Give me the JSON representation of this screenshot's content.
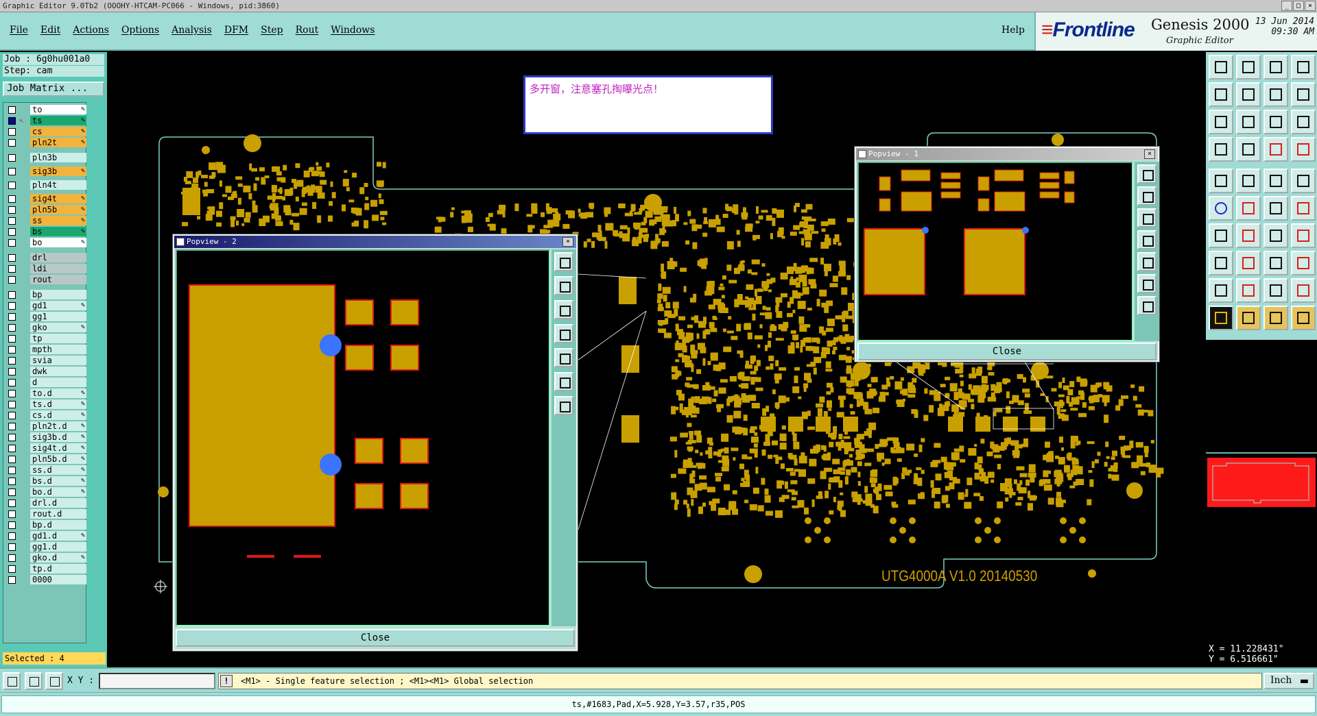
{
  "window": {
    "title": "Graphic Editor 9.0Tb2  (OOOHY-HTCAM-PC066 - Windows, pid:3860)"
  },
  "menu": {
    "items": [
      "File",
      "Edit",
      "Actions",
      "Options",
      "Analysis",
      "DFM",
      "Step",
      "Rout",
      "Windows"
    ],
    "help": "Help"
  },
  "brand": {
    "logo": "Frontline",
    "product": "Genesis 2000",
    "subtitle": "Graphic Editor",
    "date": "13 Jun 2014",
    "time": "09:30 AM"
  },
  "job": {
    "job_line": "Job : 6g0hu001a0",
    "step_line": "Step: cam",
    "matrix_button": "Job Matrix ..."
  },
  "layers": [
    {
      "name": "to",
      "color": "#ffffff",
      "checked": false,
      "editable": true
    },
    {
      "name": "ts",
      "color": "#1aa870",
      "checked": true,
      "editable": true
    },
    {
      "name": "cs",
      "color": "#f2b43c",
      "checked": false,
      "editable": true
    },
    {
      "name": "pln2t",
      "color": "#f2b43c",
      "checked": false,
      "editable": true
    },
    {
      "name": "pln3b",
      "color": "#cdeee9",
      "checked": false,
      "editable": false
    },
    {
      "name": "sig3b",
      "color": "#f2b43c",
      "checked": false,
      "editable": true
    },
    {
      "name": "pln4t",
      "color": "#cdeee9",
      "checked": false,
      "editable": false
    },
    {
      "name": "sig4t",
      "color": "#f2b43c",
      "checked": false,
      "editable": true
    },
    {
      "name": "pln5b",
      "color": "#f2b43c",
      "checked": false,
      "editable": true
    },
    {
      "name": "ss",
      "color": "#f2b43c",
      "checked": false,
      "editable": true
    },
    {
      "name": "bs",
      "color": "#1aa870",
      "checked": false,
      "editable": true
    },
    {
      "name": "bo",
      "color": "#ffffff",
      "checked": false,
      "editable": true
    },
    {
      "name": "drl",
      "color": "#b8c8c6",
      "checked": false,
      "editable": false
    },
    {
      "name": "ldi",
      "color": "#b8c8c6",
      "checked": false,
      "editable": false
    },
    {
      "name": "rout",
      "color": "#b8c8c6",
      "checked": false,
      "editable": false
    },
    {
      "name": "bp",
      "color": "#cdeee9",
      "checked": false,
      "editable": false
    },
    {
      "name": "gd1",
      "color": "#cdeee9",
      "checked": false,
      "editable": true
    },
    {
      "name": "gg1",
      "color": "#cdeee9",
      "checked": false,
      "editable": false
    },
    {
      "name": "gko",
      "color": "#cdeee9",
      "checked": false,
      "editable": true
    },
    {
      "name": "tp",
      "color": "#cdeee9",
      "checked": false,
      "editable": false
    },
    {
      "name": "mpth",
      "color": "#cdeee9",
      "checked": false,
      "editable": false
    },
    {
      "name": "svia",
      "color": "#cdeee9",
      "checked": false,
      "editable": false
    },
    {
      "name": "dwk",
      "color": "#cdeee9",
      "checked": false,
      "editable": false
    },
    {
      "name": "d",
      "color": "#cdeee9",
      "checked": false,
      "editable": false
    },
    {
      "name": "to.d",
      "color": "#cdeee9",
      "checked": false,
      "editable": true
    },
    {
      "name": "ts.d",
      "color": "#cdeee9",
      "checked": false,
      "editable": true
    },
    {
      "name": "cs.d",
      "color": "#cdeee9",
      "checked": false,
      "editable": true
    },
    {
      "name": "pln2t.d",
      "color": "#cdeee9",
      "checked": false,
      "editable": true
    },
    {
      "name": "sig3b.d",
      "color": "#cdeee9",
      "checked": false,
      "editable": true
    },
    {
      "name": "sig4t.d",
      "color": "#cdeee9",
      "checked": false,
      "editable": true
    },
    {
      "name": "pln5b.d",
      "color": "#cdeee9",
      "checked": false,
      "editable": true
    },
    {
      "name": "ss.d",
      "color": "#cdeee9",
      "checked": false,
      "editable": true
    },
    {
      "name": "bs.d",
      "color": "#cdeee9",
      "checked": false,
      "editable": true
    },
    {
      "name": "bo.d",
      "color": "#cdeee9",
      "checked": false,
      "editable": true
    },
    {
      "name": "drl.d",
      "color": "#cdeee9",
      "checked": false,
      "editable": false
    },
    {
      "name": "rout.d",
      "color": "#cdeee9",
      "checked": false,
      "editable": false
    },
    {
      "name": "bp.d",
      "color": "#cdeee9",
      "checked": false,
      "editable": false
    },
    {
      "name": "gd1.d",
      "color": "#cdeee9",
      "checked": false,
      "editable": true
    },
    {
      "name": "gg1.d",
      "color": "#cdeee9",
      "checked": false,
      "editable": false
    },
    {
      "name": "gko.d",
      "color": "#cdeee9",
      "checked": false,
      "editable": true
    },
    {
      "name": "tp.d",
      "color": "#cdeee9",
      "checked": false,
      "editable": false
    },
    {
      "name": "0000",
      "color": "#cdeee9",
      "checked": false,
      "editable": false
    }
  ],
  "selected": "Selected : 4",
  "canvas": {
    "note": "多开窗，注意塞孔掏曝光点！",
    "board_label": "UTG4000A V1.0  20140530",
    "colors": {
      "pad": "#c9a000",
      "pad_outline": "#e01818",
      "board_outline": "#7fd0c8",
      "highlight": "#3a74ff"
    }
  },
  "popview1": {
    "title": "Popview - 1",
    "close_label": "Close"
  },
  "popview2": {
    "title": "Popview - 2",
    "close_label": "Close"
  },
  "coords": {
    "x": "X = 11.228431\"",
    "y": "Y = 6.516661\""
  },
  "status": {
    "xy_label": "X Y :",
    "xy_value": "",
    "hint": "<M1> - Single feature selection ; <M1><M1> Global selection",
    "unit": "Inch",
    "feature_info": "ts,#1683,Pad,X=5.928,Y=3.57,r35,POS"
  }
}
